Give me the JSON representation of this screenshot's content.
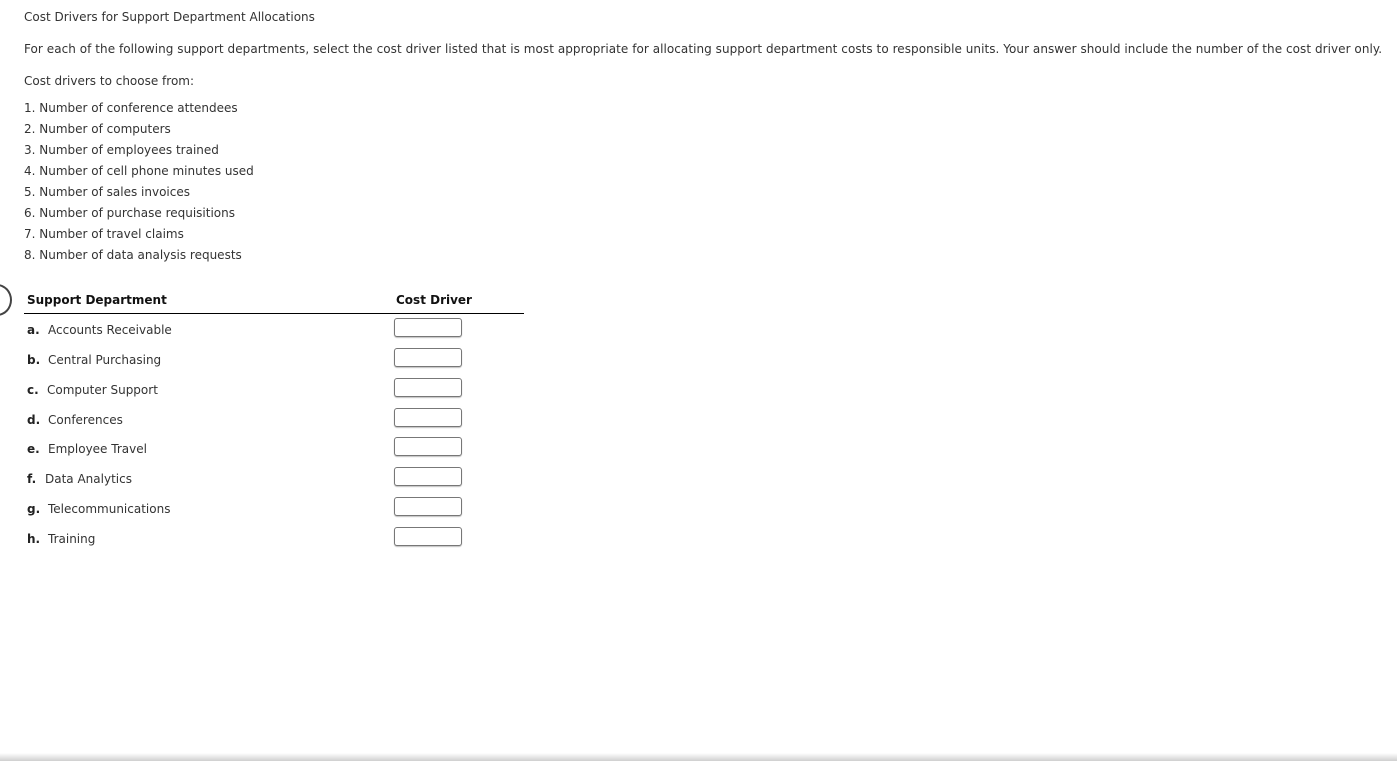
{
  "page": {
    "title": "Cost Drivers for Support Department Allocations",
    "instructions": "For each of the following support departments, select the cost driver listed that is most appropriate for allocating support department costs to responsible units. Your answer should include the number of the cost driver only.",
    "choose_label": "Cost drivers to choose from:"
  },
  "cost_drivers": [
    "1. Number of conference attendees",
    "2. Number of computers",
    "3. Number of employees trained",
    "4. Number of cell phone minutes used",
    "5. Number of sales invoices",
    "6. Number of purchase requisitions",
    "7. Number of travel claims",
    "8. Number of data analysis requests"
  ],
  "table": {
    "headers": {
      "department": "Support Department",
      "driver": "Cost Driver"
    },
    "rows": [
      {
        "letter": "a.",
        "department": "Accounts Receivable",
        "value": ""
      },
      {
        "letter": "b.",
        "department": "Central Purchasing",
        "value": ""
      },
      {
        "letter": "c.",
        "department": "Computer Support",
        "value": ""
      },
      {
        "letter": "d.",
        "department": "Conferences",
        "value": ""
      },
      {
        "letter": "e.",
        "department": "Employee Travel",
        "value": ""
      },
      {
        "letter": "f.",
        "department": "Data Analytics",
        "value": ""
      },
      {
        "letter": "g.",
        "department": "Telecommunications",
        "value": ""
      },
      {
        "letter": "h.",
        "department": "Training",
        "value": ""
      }
    ]
  }
}
